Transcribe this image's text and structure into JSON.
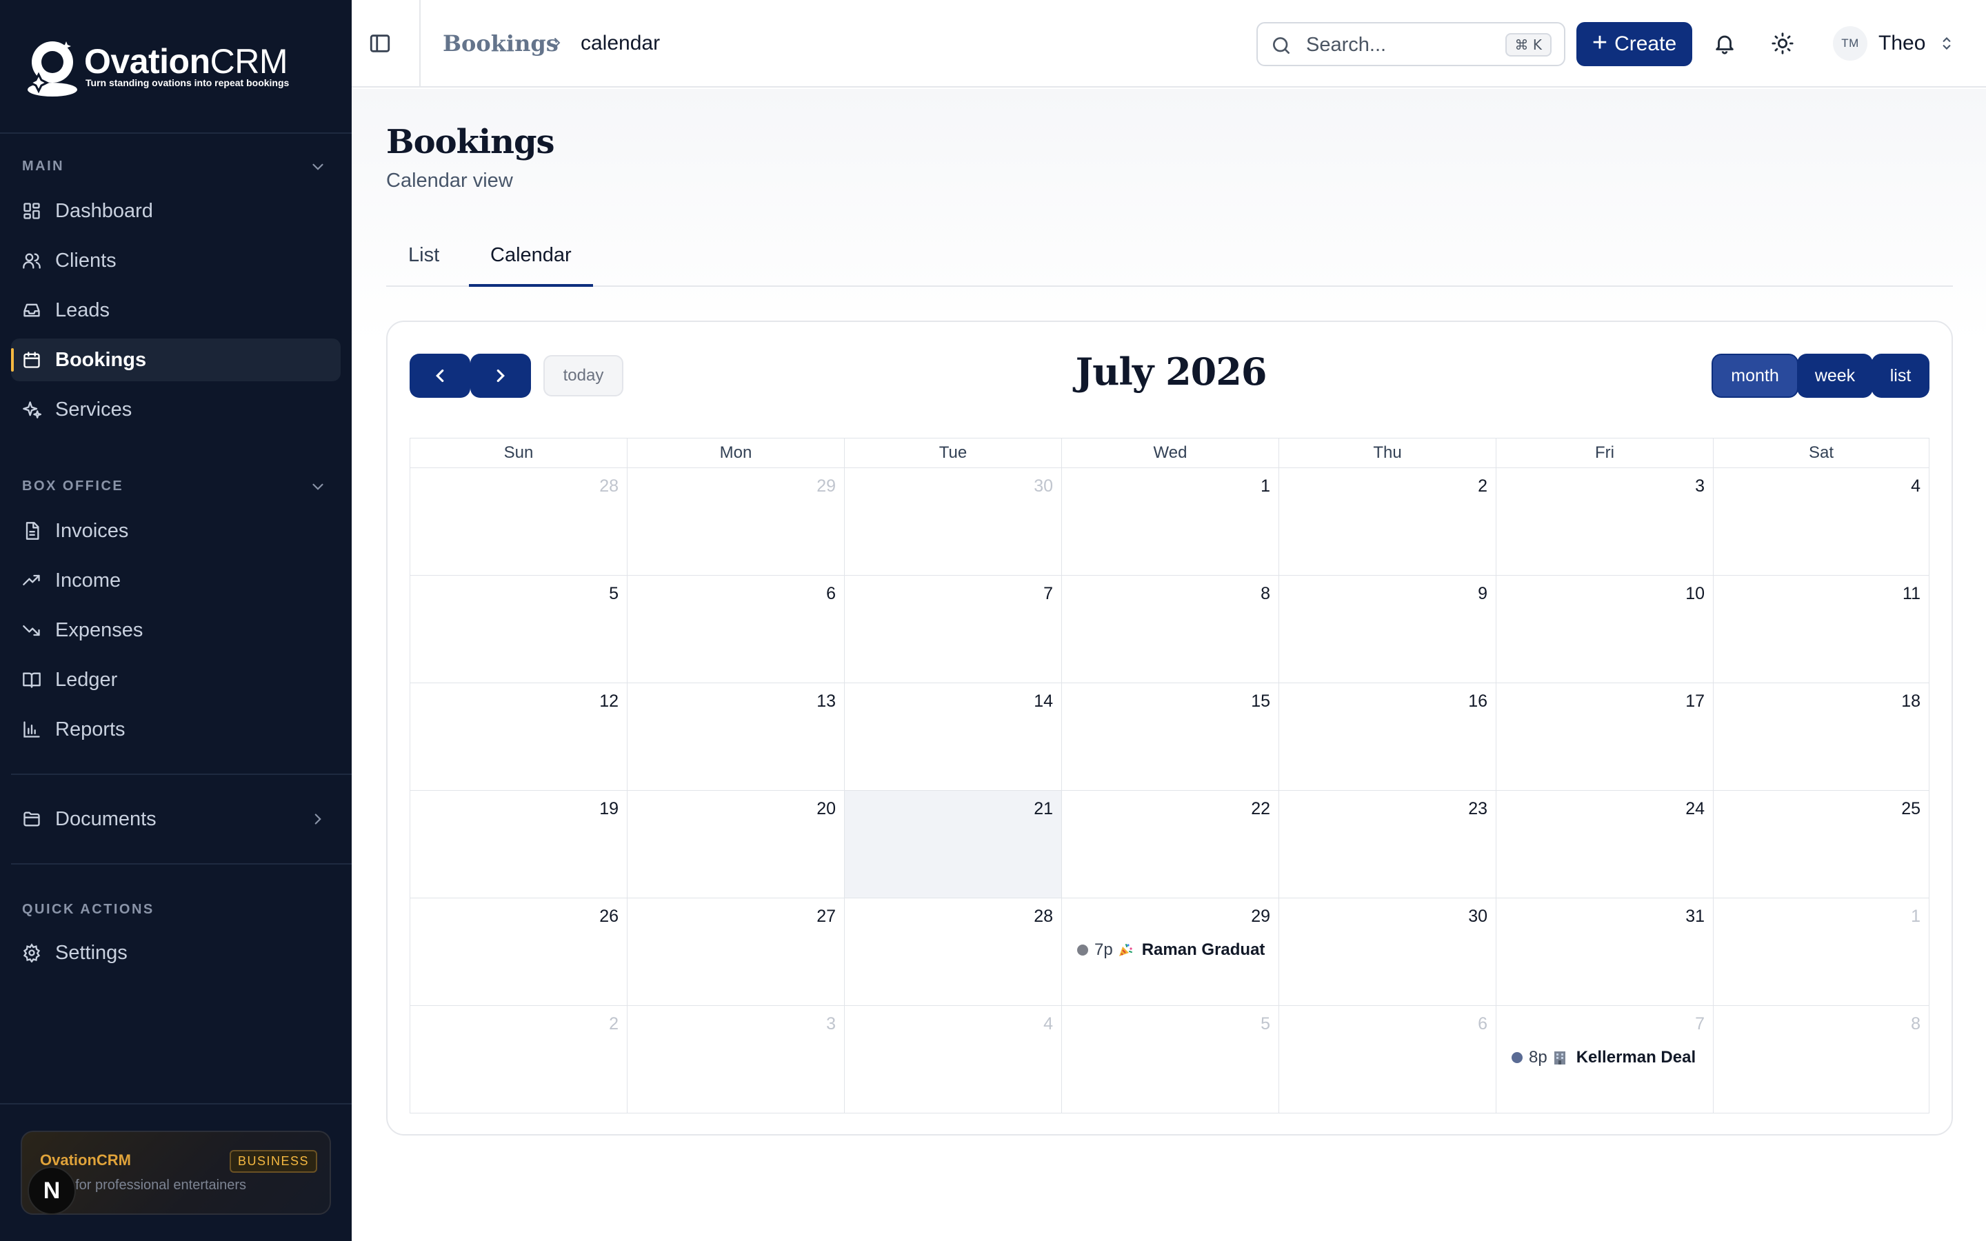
{
  "brand": {
    "name_bold": "Ovation",
    "name_light": "CRM",
    "tagline": "Turn standing ovations into repeat bookings"
  },
  "sidebar": {
    "sections": [
      {
        "label": "MAIN"
      },
      {
        "label": "BOX OFFICE"
      },
      {
        "label": "QUICK ACTIONS"
      }
    ],
    "main_items": [
      {
        "label": "Dashboard",
        "icon": "dashboard-icon"
      },
      {
        "label": "Clients",
        "icon": "users-icon"
      },
      {
        "label": "Leads",
        "icon": "inbox-icon"
      },
      {
        "label": "Bookings",
        "icon": "calendar-icon",
        "active": true
      },
      {
        "label": "Services",
        "icon": "sparkles-icon"
      }
    ],
    "box_office_items": [
      {
        "label": "Invoices",
        "icon": "file-icon"
      },
      {
        "label": "Income",
        "icon": "trending-up-icon"
      },
      {
        "label": "Expenses",
        "icon": "trending-down-icon"
      },
      {
        "label": "Ledger",
        "icon": "book-icon"
      },
      {
        "label": "Reports",
        "icon": "bar-chart-icon"
      }
    ],
    "documents": {
      "label": "Documents",
      "icon": "folder-icon"
    },
    "quick_actions": [
      {
        "label": "Settings",
        "icon": "gear-icon"
      }
    ],
    "promo": {
      "title": "OvationCRM",
      "badge": "BUSINESS",
      "subtitle": "CRM for professional entertainers"
    },
    "n_badge": "N"
  },
  "topbar": {
    "breadcrumb_root": "Bookings",
    "breadcrumb_current": "calendar",
    "search_placeholder": "Search...",
    "search_shortcut": "⌘ K",
    "create_label": "Create",
    "avatar_initials": "TM",
    "user_name": "Theo"
  },
  "page": {
    "title": "Bookings",
    "subtitle": "Calendar view",
    "tabs": [
      {
        "label": "List"
      },
      {
        "label": "Calendar",
        "active": true
      }
    ]
  },
  "calendar": {
    "title": "July 2026",
    "today_label": "today",
    "views": [
      "month",
      "week",
      "list"
    ],
    "active_view": "month",
    "weekdays": [
      "Sun",
      "Mon",
      "Tue",
      "Wed",
      "Thu",
      "Fri",
      "Sat"
    ],
    "today_date": 21,
    "weeks": [
      [
        {
          "d": "28",
          "o": true
        },
        {
          "d": "29",
          "o": true
        },
        {
          "d": "30",
          "o": true
        },
        {
          "d": "1"
        },
        {
          "d": "2"
        },
        {
          "d": "3"
        },
        {
          "d": "4"
        }
      ],
      [
        {
          "d": "5"
        },
        {
          "d": "6"
        },
        {
          "d": "7"
        },
        {
          "d": "8"
        },
        {
          "d": "9"
        },
        {
          "d": "10"
        },
        {
          "d": "11"
        }
      ],
      [
        {
          "d": "12"
        },
        {
          "d": "13"
        },
        {
          "d": "14"
        },
        {
          "d": "15"
        },
        {
          "d": "16"
        },
        {
          "d": "17"
        },
        {
          "d": "18"
        }
      ],
      [
        {
          "d": "19"
        },
        {
          "d": "20"
        },
        {
          "d": "21",
          "today": true
        },
        {
          "d": "22"
        },
        {
          "d": "23"
        },
        {
          "d": "24"
        },
        {
          "d": "25"
        }
      ],
      [
        {
          "d": "26"
        },
        {
          "d": "27"
        },
        {
          "d": "28"
        },
        {
          "d": "29"
        },
        {
          "d": "30"
        },
        {
          "d": "31"
        },
        {
          "d": "1",
          "o": true
        }
      ],
      [
        {
          "d": "2",
          "o": true
        },
        {
          "d": "3",
          "o": true
        },
        {
          "d": "4",
          "o": true
        },
        {
          "d": "5",
          "o": true
        },
        {
          "d": "6",
          "o": true
        },
        {
          "d": "7",
          "o": true
        },
        {
          "d": "8",
          "o": true
        }
      ]
    ],
    "events": [
      {
        "week": 4,
        "day": 3,
        "time": "7p",
        "emoji": "party-popper-icon",
        "title": "Raman Graduat",
        "dot_color": "#7c7f88"
      },
      {
        "week": 5,
        "day": 5,
        "time": "8p",
        "emoji": "office-building-icon",
        "title": "Kellerman Deal",
        "dot_color": "#5a6b94"
      }
    ]
  },
  "colors": {
    "sidebar_bg": "#0d1629",
    "accent": "#0e2f7e",
    "active_marker": "#f5b841",
    "today_cell": "#f1f3f7"
  }
}
